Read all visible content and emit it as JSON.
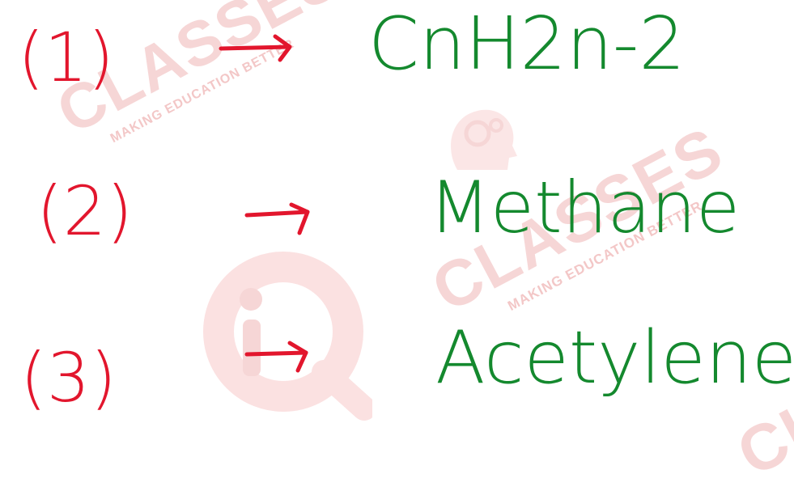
{
  "watermark": {
    "brand": "CLASSES",
    "tagline": "MAKING EDUCATION BETTER",
    "colors": {
      "light": "#f6d6d6",
      "mid": "#f3c7c7"
    }
  },
  "colors": {
    "number": "#e2162d",
    "answer": "#14892e"
  },
  "answers": [
    {
      "label": "(1)",
      "arrow": "→",
      "text": "CnH2n-2"
    },
    {
      "label": "(2)",
      "arrow": "→",
      "text": "Methane"
    },
    {
      "label": "(3)",
      "arrow": "→",
      "text": "Acetylene"
    }
  ]
}
